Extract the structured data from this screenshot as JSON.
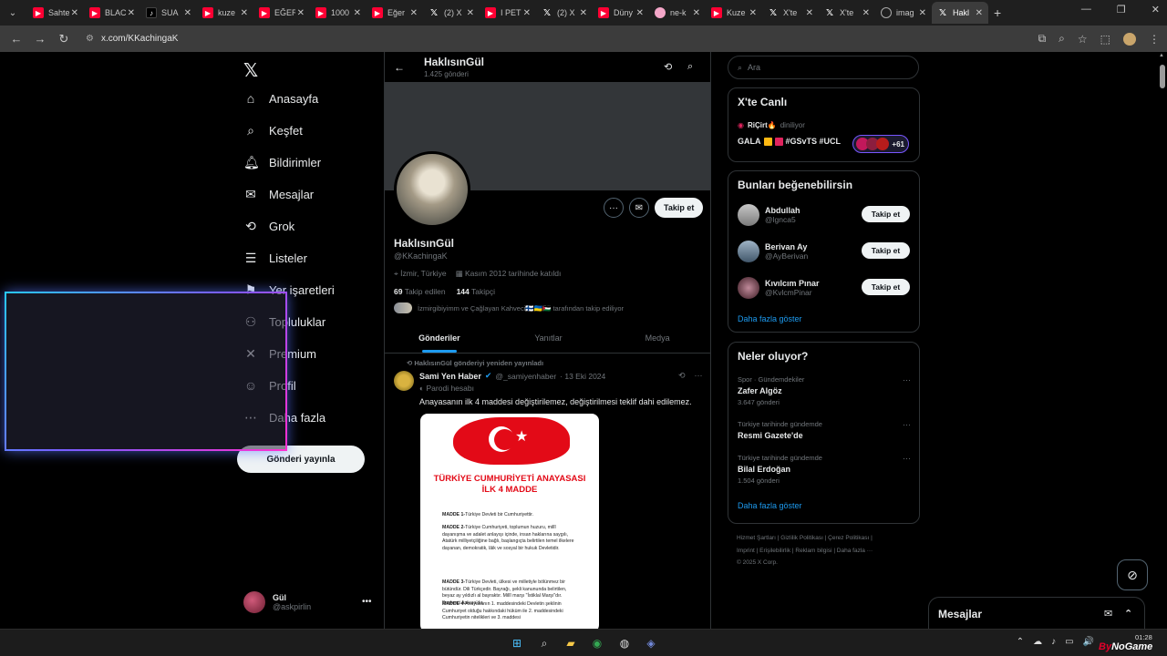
{
  "browser": {
    "tabs": [
      {
        "label": "Sahte",
        "icon": "youtube-icon",
        "kind": "yt"
      },
      {
        "label": "BLAC",
        "icon": "youtube-icon",
        "kind": "yt"
      },
      {
        "label": "SUA",
        "icon": "tiktok-icon",
        "kind": "tt"
      },
      {
        "label": "kuze",
        "icon": "youtube-icon",
        "kind": "yt"
      },
      {
        "label": "EĞER",
        "icon": "youtube-icon",
        "kind": "yt"
      },
      {
        "label": "1000",
        "icon": "youtube-icon",
        "kind": "yt"
      },
      {
        "label": "Eğer",
        "icon": "youtube-icon",
        "kind": "yt"
      },
      {
        "label": "(2) X",
        "icon": "x-icon",
        "kind": "x"
      },
      {
        "label": "I PET",
        "icon": "youtube-icon",
        "kind": "yt"
      },
      {
        "label": "(2) X",
        "icon": "x-icon",
        "kind": "x"
      },
      {
        "label": "Düny",
        "icon": "youtube-icon",
        "kind": "yt"
      },
      {
        "label": "ne-k",
        "icon": "site-icon",
        "kind": "pk"
      },
      {
        "label": "Kuze",
        "icon": "youtube-icon",
        "kind": "yt"
      },
      {
        "label": "X'te",
        "icon": "x-icon",
        "kind": "x"
      },
      {
        "label": "X'te",
        "icon": "x-icon",
        "kind": "x"
      },
      {
        "label": "imag",
        "icon": "globe-icon",
        "kind": "gl"
      },
      {
        "label": "Hakl",
        "icon": "x-icon",
        "kind": "x",
        "active": true
      }
    ],
    "url": "x.com/KKachingaK"
  },
  "nav": {
    "items": [
      {
        "label": "Anasayfa",
        "icon": "home-icon"
      },
      {
        "label": "Keşfet",
        "icon": "search-icon"
      },
      {
        "label": "Bildirimler",
        "icon": "bell-icon"
      },
      {
        "label": "Mesajlar",
        "icon": "mail-icon"
      },
      {
        "label": "Grok",
        "icon": "grok-icon"
      },
      {
        "label": "Listeler",
        "icon": "list-icon"
      },
      {
        "label": "Yer işaretleri",
        "icon": "bookmark-icon"
      },
      {
        "label": "Topluluklar",
        "icon": "communities-icon"
      },
      {
        "label": "Premium",
        "icon": "premium-icon"
      },
      {
        "label": "Profil",
        "icon": "profile-icon"
      },
      {
        "label": "Daha fazla",
        "icon": "more-icon"
      }
    ],
    "post_button": "Gönderi yayınla",
    "me": {
      "name": "Gül",
      "handle": "@askpirlin"
    }
  },
  "profile": {
    "name": "HaklısınGül",
    "post_count": "1.425 gönderi",
    "handle": "@KKachingaK",
    "location": "İzmir, Türkiye",
    "joined": "Kasım 2012 tarihinde katıldı",
    "following_count": "69",
    "following_label": "Takip edilen",
    "followers_count": "144",
    "followers_label": "Takipçi",
    "followed_by": "İzmirgibiyimm ve Çağlayan Kahveci🇫🇮🇺🇦🇵🇸 tarafından takip ediliyor",
    "follow_button": "Takip et",
    "tabs": [
      "Gönderiler",
      "Yanıtlar",
      "Medya"
    ]
  },
  "tweet": {
    "repost_note": "HaklısınGül gönderiyi yeniden yayınladı",
    "author": "Sami Yen Haber",
    "handle": "@_samiyenhaber",
    "date": "· 13 Eki 2024",
    "parody": "Parodi hesabı",
    "text": "Anayasanın ilk 4 maddesi değiştirilemez, değiştirilmesi teklif dahi edilemez.",
    "image": {
      "title": "TÜRKİYE CUMHURİYETİ ANAYASASI İLK 4 MADDE",
      "articles": [
        {
          "head": "MADDE 1-",
          "body": "Türkiye Devleti bir Cumhuriyettir."
        },
        {
          "head": "MADDE 2-",
          "body": "Türkiye Cumhuriyeti, toplumun huzuru, millî dayanışma ve adalet anlayışı içinde, insan haklarına saygılı, Atatürk milliyetçiliğine bağlı, başlangıçta belirtilen temel ilkelere dayanan, demokratik, lâik ve sosyal bir hukuk Devletidir."
        },
        {
          "head": "MADDE 3-",
          "body": "Türkiye Devleti, ülkesi ve milletiyle bölünmez bir bütündür. Dili Türkçedir. Bayrağı, şekli kanununda belirtilen, beyaz ay yıldızlı al bayraktır. Millî marşı \"İstiklal Marşı\"dır. Başkenti Ankara'dır."
        },
        {
          "head": "MADDE 4-",
          "body": "Anayasanın 1. maddesindeki Devletin şeklinin Cumhuriyet olduğu hakkındaki hüküm ile 2. maddesindeki Cumhuriyetin nitelikleri ve 3. maddesi"
        }
      ]
    }
  },
  "right": {
    "search_placeholder": "Ara",
    "live": {
      "title": "X'te Canlı",
      "host": "RiÇirt🔥",
      "status": "diniliyor",
      "topic": "GALA",
      "tags": "#GSvTS #UCL",
      "count": "+61"
    },
    "suggest": {
      "title": "Bunları beğenebilirsin",
      "users": [
        {
          "name": "Abdullah",
          "handle": "@lgnca5"
        },
        {
          "name": "Berivan Ay",
          "handle": "@AyBerivan"
        },
        {
          "name": "Kıvılcım Pınar",
          "handle": "@KvlcmPinar"
        }
      ],
      "follow": "Takip et",
      "more": "Daha fazla göster"
    },
    "trends": {
      "title": "Neler oluyor?",
      "items": [
        {
          "cat": "Spor · Gündemdekiler",
          "title": "Zafer Algöz",
          "count": "3.647 gönderi"
        },
        {
          "cat": "Türkiye tarihinde gündemde",
          "title": "Resmi Gazete'de",
          "count": ""
        },
        {
          "cat": "Türkiye tarihinde gündemde",
          "title": "Bilal Erdoğan",
          "count": "1.504 gönderi"
        }
      ],
      "more": "Daha fazla göster"
    },
    "footer": {
      "line1": "Hizmet Şartları  |  Gizlilik Politikası  |  Çerez Politikası  |",
      "line2": "Imprint  |  Erişilebilirlik  |  Reklam bilgisi  |  Daha fazla ···",
      "line3": "© 2025 X Corp."
    }
  },
  "drawer": {
    "title": "Mesajlar"
  },
  "taskbar": {
    "time": "01:28"
  },
  "watermark": {
    "a": "By",
    "b": "NoGame"
  }
}
